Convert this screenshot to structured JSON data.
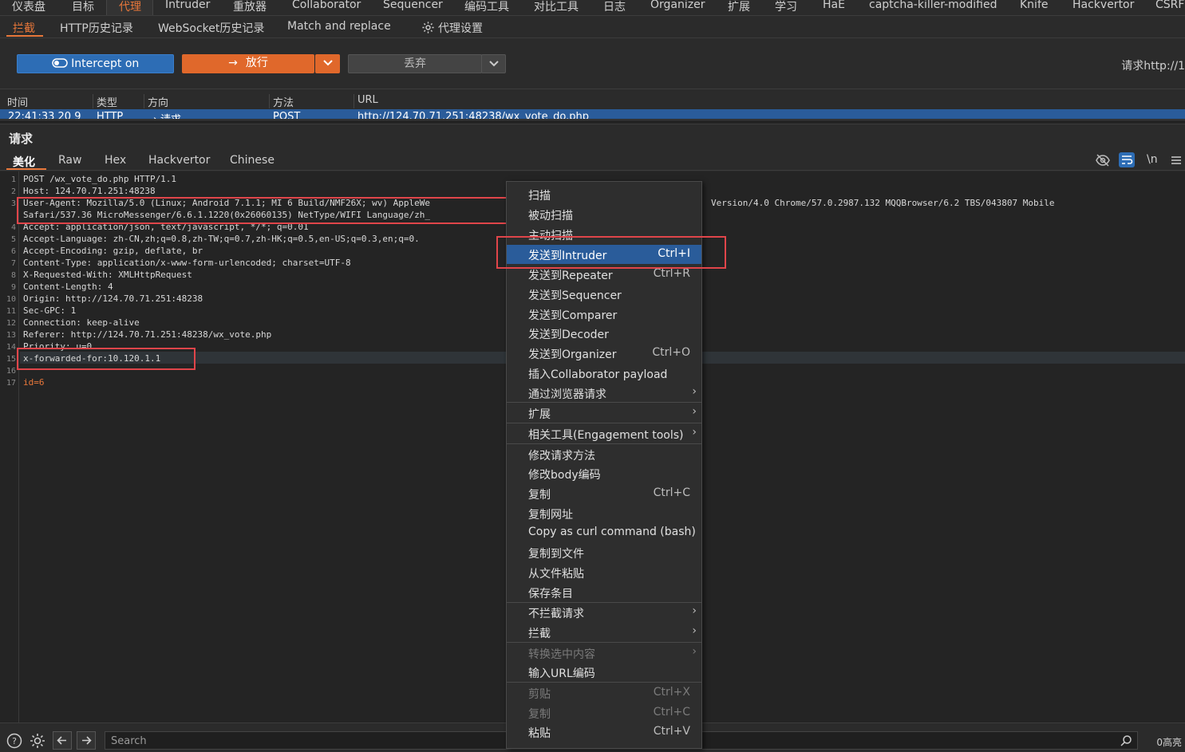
{
  "top_nav": {
    "items": [
      "仪表盘",
      "目标",
      "代理",
      "Intruder",
      "重放器",
      "Collaborator",
      "Sequencer",
      "编码工具",
      "对比工具",
      "日志",
      "Organizer",
      "扩展",
      "学习",
      "HaE",
      "captcha-killer-modified",
      "Knife",
      "Hackvertor",
      "CSRF"
    ],
    "active": "代理"
  },
  "sub_nav": {
    "items": [
      "拦截",
      "HTTP历史记录",
      "WebSocket历史记录",
      "Match and replace"
    ],
    "settings_label": "代理设置",
    "active": "拦截"
  },
  "toolbar": {
    "intercept_label": "Intercept on",
    "forward_label": "放行",
    "drop_label": "丢弃",
    "request_target": "请求http://1"
  },
  "table": {
    "headers": [
      "时间",
      "类型",
      "方向",
      "方法",
      "URL"
    ],
    "row": {
      "time": "22:41:33 20 9",
      "type": "HTTP",
      "direction": "→ 请求",
      "method": "POST",
      "url": "http://124.70.71.251:48238/wx_vote_do.php"
    }
  },
  "request_panel": {
    "title": "请求",
    "tabs": [
      "美化",
      "Raw",
      "Hex",
      "Hackvertor",
      "Chinese"
    ],
    "active_tab": "美化",
    "icons": [
      "eye-off-icon",
      "wrap-icon",
      "newline-icon",
      "menu-icon"
    ],
    "newline_label": "\\n"
  },
  "editor": {
    "line_numbers": [
      "1",
      "2",
      "3",
      "",
      "4",
      "5",
      "6",
      "7",
      "8",
      "9",
      "10",
      "11",
      "12",
      "13",
      "14",
      "15",
      "16",
      "17"
    ],
    "lines": [
      "POST /wx_vote_do.php HTTP/1.1",
      "Host: 124.70.71.251:48238",
      "User-Agent: Mozilla/5.0 (Linux; Android 7.1.1; MI 6 Build/NMF26X; wv) AppleWe",
      "Safari/537.36 MicroMessenger/6.6.1.1220(0x26060135) NetType/WIFI Language/zh_",
      "Accept: application/json, text/javascript, */*; q=0.01",
      "Accept-Language: zh-CN,zh;q=0.8,zh-TW;q=0.7,zh-HK;q=0.5,en-US;q=0.3,en;q=0.",
      "Accept-Encoding: gzip, deflate, br",
      "Content-Type: application/x-www-form-urlencoded; charset=UTF-8",
      "X-Requested-With: XMLHttpRequest",
      "Content-Length: 4",
      "Origin: http://124.70.71.251:48238",
      "Sec-GPC: 1",
      "Connection: keep-alive",
      "Referer: http://124.70.71.251:48238/wx_vote.php",
      "Priority: u=0",
      "x-forwarded-for:10.120.1.1",
      "",
      "id=6"
    ],
    "ua_continuation": "Version/4.0 Chrome/57.0.2987.132 MQQBrowser/6.2 TBS/043807 Mobile"
  },
  "context_menu": {
    "items": [
      {
        "label": "扫描",
        "shortcut": ""
      },
      {
        "label": "被动扫描",
        "shortcut": ""
      },
      {
        "label": "主动扫描",
        "shortcut": ""
      },
      {
        "label": "发送到Intruder",
        "shortcut": "Ctrl+I",
        "selected": true
      },
      {
        "label": "发送到Repeater",
        "shortcut": "Ctrl+R"
      },
      {
        "label": "发送到Sequencer",
        "shortcut": ""
      },
      {
        "label": "发送到Comparer",
        "shortcut": ""
      },
      {
        "label": "发送到Decoder",
        "shortcut": ""
      },
      {
        "label": "发送到Organizer",
        "shortcut": "Ctrl+O"
      },
      {
        "label": "插入Collaborator payload",
        "shortcut": ""
      },
      {
        "label": "通过浏览器请求",
        "shortcut": "",
        "submenu": true
      },
      {
        "label": "扩展",
        "shortcut": "",
        "submenu": true
      },
      {
        "label": "相关工具(Engagement tools)",
        "shortcut": "",
        "submenu": true
      },
      {
        "label": "修改请求方法",
        "shortcut": ""
      },
      {
        "label": "修改body编码",
        "shortcut": ""
      },
      {
        "label": "复制",
        "shortcut": "Ctrl+C"
      },
      {
        "label": "复制网址",
        "shortcut": ""
      },
      {
        "label": "Copy as curl command (bash)",
        "shortcut": ""
      },
      {
        "label": "复制到文件",
        "shortcut": ""
      },
      {
        "label": "从文件粘贴",
        "shortcut": ""
      },
      {
        "label": "保存条目",
        "shortcut": ""
      },
      {
        "label": "不拦截请求",
        "shortcut": "",
        "submenu": true
      },
      {
        "label": "拦截",
        "shortcut": "",
        "submenu": true
      },
      {
        "label": "转换选中内容",
        "shortcut": "",
        "submenu": true,
        "disabled": true
      },
      {
        "label": "输入URL编码",
        "shortcut": ""
      },
      {
        "label": "剪贴",
        "shortcut": "Ctrl+X",
        "disabled": true
      },
      {
        "label": "复制",
        "shortcut": "Ctrl+C",
        "disabled": true
      },
      {
        "label": "粘贴",
        "shortcut": "Ctrl+V"
      }
    ]
  },
  "bottom": {
    "search_placeholder": "Search",
    "highlight_count": "0高亮"
  },
  "colors": {
    "accent": "#e8773a",
    "selection": "#2a5c9a",
    "intercept_btn": "#2d6db5",
    "annotation_red": "#e0454a"
  }
}
